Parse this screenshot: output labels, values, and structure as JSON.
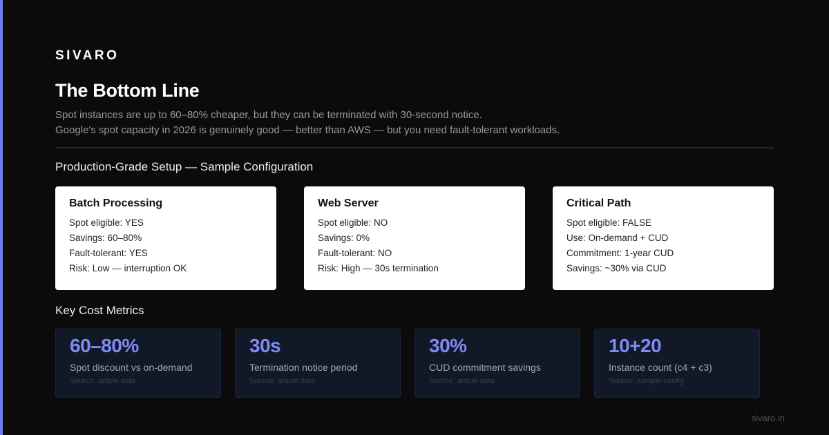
{
  "brand": "SIVARO",
  "title": "The Bottom Line",
  "subtitle": {
    "line1": "Spot instances are up to 60–80% cheaper, but they can be terminated with 30-second notice.",
    "line2": "Google's spot capacity in 2026 is genuinely good — better than AWS — but you need fault-tolerant workloads."
  },
  "config_section": {
    "heading": "Production-Grade Setup — Sample Configuration",
    "cards": [
      {
        "title": "Batch Processing",
        "lines": [
          "Spot eligible: YES",
          "Savings: 60–80%",
          "Fault-tolerant: YES",
          "Risk: Low — interruption OK"
        ]
      },
      {
        "title": "Web Server",
        "lines": [
          "Spot eligible: NO",
          "Savings: 0%",
          "Fault-tolerant: NO",
          "Risk: High — 30s termination"
        ]
      },
      {
        "title": "Critical Path",
        "lines": [
          "Spot eligible: FALSE",
          "Use: On-demand + CUD",
          "Commitment: 1-year CUD",
          "Savings: ~30% via CUD"
        ]
      }
    ]
  },
  "metrics_section": {
    "heading": "Key Cost Metrics",
    "metrics": [
      {
        "value": "60–80%",
        "label": "Spot discount vs on-demand",
        "source": "Source: article data"
      },
      {
        "value": "30s",
        "label": "Termination notice period",
        "source": "Source: article data"
      },
      {
        "value": "30%",
        "label": "CUD commitment savings",
        "source": "Source: article data"
      },
      {
        "value": "10+20",
        "label": "Instance count (c4 + c3)",
        "source": "Source: sample config"
      }
    ]
  },
  "footer": "sivaro.in",
  "colors": {
    "background": "#0b0b0b",
    "accent": "#6f7bf0",
    "metric_value": "#7f8bf3",
    "card_background": "#ffffff",
    "metric_background": "#111827"
  }
}
